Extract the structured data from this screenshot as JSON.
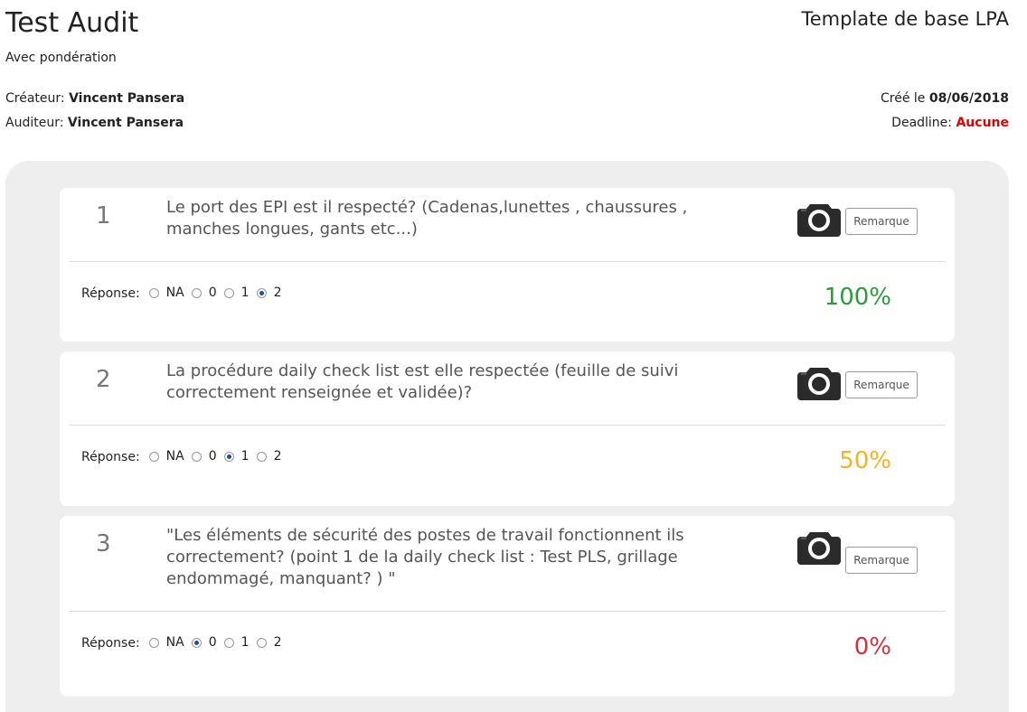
{
  "header": {
    "title": "Test Audit",
    "subtitle": "Avec pondération",
    "template": "Template de base LPA",
    "creator_label": "Créateur:",
    "creator_value": "Vincent Pansera",
    "auditor_label": "Auditeur:",
    "auditor_value": "Vincent Pansera",
    "created_label": "Créé le",
    "created_value": "08/06/2018",
    "deadline_label": "Deadline:",
    "deadline_value": "Aucune"
  },
  "colors": {
    "green": "#2a9d3a",
    "orange": "#f5b324",
    "red": "#d1343f",
    "deadline": "#e00000"
  },
  "questions": [
    {
      "number": "1",
      "text": "Le port des EPI est il respecté? (Cadenas,lunettes , chaussures , manches longues, gants etc...)",
      "remark_label": "Remarque",
      "answer_label": "Réponse:",
      "options": [
        "NA",
        "0",
        "1",
        "2"
      ],
      "selected": "2",
      "score": "100%",
      "score_color": "#2a9d3a"
    },
    {
      "number": "2",
      "text": "La procédure daily check list est elle respectée (feuille de suivi correctement renseignée et validée)?",
      "remark_label": "Remarque",
      "answer_label": "Réponse:",
      "options": [
        "NA",
        "0",
        "1",
        "2"
      ],
      "selected": "1",
      "score": "50%",
      "score_color": "#f5b324"
    },
    {
      "number": "3",
      "text": "\"Les éléments de sécurité des postes de travail fonctionnent ils correctement? (point 1 de la daily check list : Test PLS, grillage endommagé, manquant? ) \"",
      "remark_label": "Remarque",
      "answer_label": "Réponse:",
      "options": [
        "NA",
        "0",
        "1",
        "2"
      ],
      "selected": "0",
      "score": "0%",
      "score_color": "#d1343f"
    }
  ]
}
